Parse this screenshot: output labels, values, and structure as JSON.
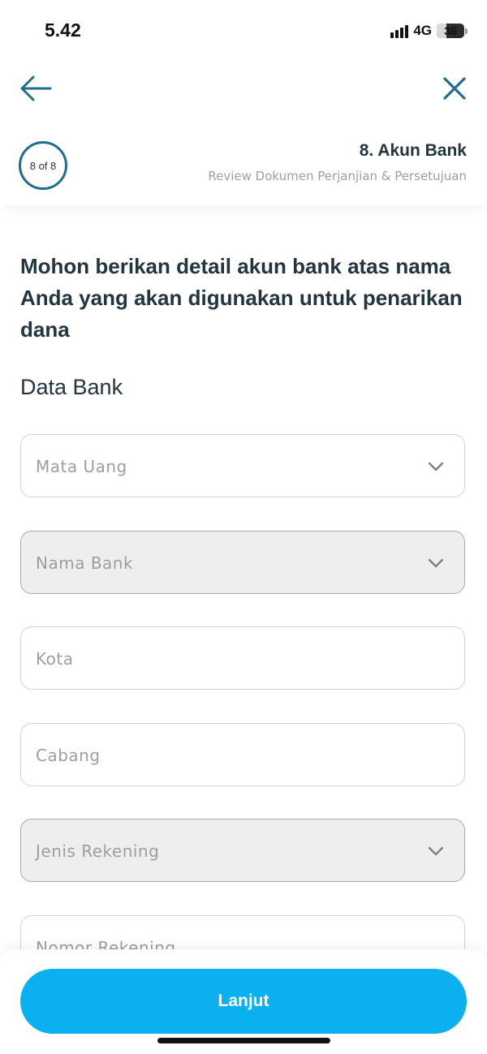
{
  "status_bar": {
    "time": "5.42",
    "network": "4G",
    "battery": "36",
    "battery_level": 0.36
  },
  "header": {
    "back_icon": "arrow-left-icon",
    "close_icon": "close-icon",
    "step_indicator": "8 of 8",
    "step_title": "8. Akun Bank",
    "step_subtitle": "Review Dokumen Perjanjian & Persetujuan"
  },
  "main": {
    "heading": "Mohon berikan detail akun bank atas nama Anda yang akan digunakan untuk penarikan dana",
    "section_label": "Data Bank",
    "fields": [
      {
        "placeholder": "Mata Uang",
        "type": "select",
        "disabled": false
      },
      {
        "placeholder": "Nama Bank",
        "type": "select",
        "disabled": true
      },
      {
        "placeholder": "Kota",
        "type": "text",
        "disabled": false
      },
      {
        "placeholder": "Cabang",
        "type": "text",
        "disabled": false
      },
      {
        "placeholder": "Jenis Rekening",
        "type": "select",
        "disabled": true
      },
      {
        "placeholder": "Nomor Rekening",
        "type": "text",
        "disabled": false
      }
    ]
  },
  "footer": {
    "next_label": "Lanjut"
  },
  "colors": {
    "accent": "#0ab0f0",
    "icon": "#1e6e91",
    "text": "#233540",
    "placeholder": "#9a9fa3"
  }
}
